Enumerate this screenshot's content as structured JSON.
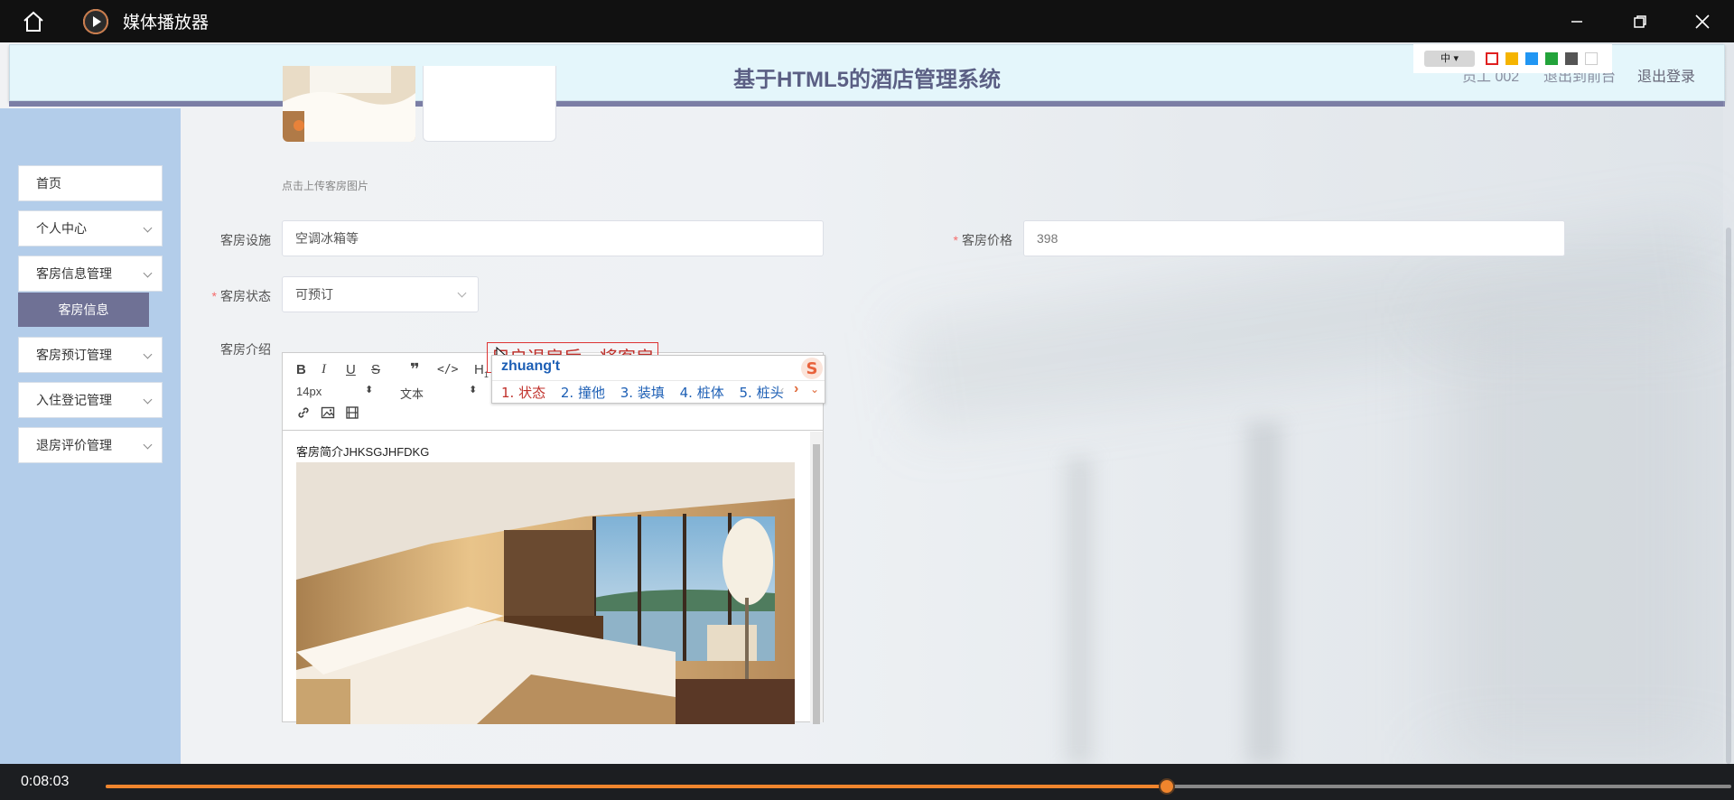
{
  "player": {
    "title": "媒体播放器",
    "time": "0:08:03",
    "progress": 0.653
  },
  "header": {
    "title": "基于HTML5的酒店管理系统",
    "user": "员工 002",
    "back_front": "退出到前台",
    "logout": "退出登录"
  },
  "ime_toolbar": {
    "lang": "中 ▾",
    "swatches": [
      "#e02020",
      "#f5b400",
      "#2196f3",
      "#22a33a",
      "#555555",
      "#ffffff"
    ]
  },
  "sidebar": {
    "items": [
      {
        "label": "首页"
      },
      {
        "label": "个人中心"
      },
      {
        "label": "客房信息管理"
      },
      {
        "label": "客房预订管理"
      },
      {
        "label": "入住登记管理"
      },
      {
        "label": "退房评价管理"
      }
    ],
    "active_sub": "客房信息"
  },
  "form": {
    "upload_hint": "点击上传客房图片",
    "facilities_label": "客房设施",
    "facilities_value": "空调冰箱等",
    "price_label": "客房价格",
    "price_value": "398",
    "status_label": "客房状态",
    "status_value": "可预订",
    "intro_label": "客房介绍"
  },
  "editor": {
    "font_size": "14px",
    "text_style": "文本",
    "content_line": "客房简介JHKSGJHFDKG"
  },
  "ime": {
    "preedit": "用户退房后，将客房",
    "pinyin": "zhuang't",
    "candidates": [
      "1. 状态",
      "2. 撞他",
      "3. 装填",
      "4. 桩体",
      "5. 桩头"
    ]
  }
}
